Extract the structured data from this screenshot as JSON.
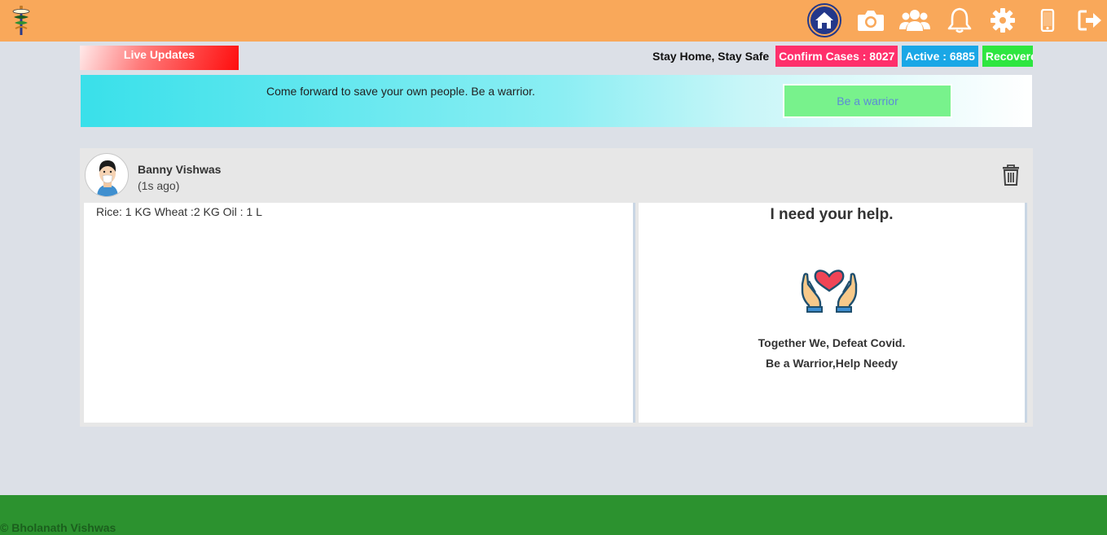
{
  "topbar": {
    "logo_icon": "caduceus-icon",
    "icons": [
      "home-icon",
      "camera-icon",
      "users-icon",
      "bell-icon",
      "gear-icon",
      "mobile-icon",
      "logout-icon"
    ],
    "color": "#f9a85a"
  },
  "live_updates": {
    "label": "Live Updates"
  },
  "ticker": {
    "stay": "Stay Home, Stay Safe",
    "confirm": "Confirm Cases : 8027",
    "active": "Active : 6885",
    "recovered": "Recovered"
  },
  "banner": {
    "text": "Come forward to save your own people. Be a warrior.",
    "button": "Be a warrior"
  },
  "post": {
    "user_name": "Banny Vishwas",
    "time": "(1s ago)",
    "items": "Rice: 1 KG Wheat :2 KG Oil : 1 L",
    "help_title": "I need your help.",
    "slogan_1": "Together We, Defeat Covid.",
    "slogan_2": "Be a Warrior,Help Needy"
  },
  "footer": {
    "copyright": "© Bholanath Vishwas",
    "color": "#2c922f"
  }
}
